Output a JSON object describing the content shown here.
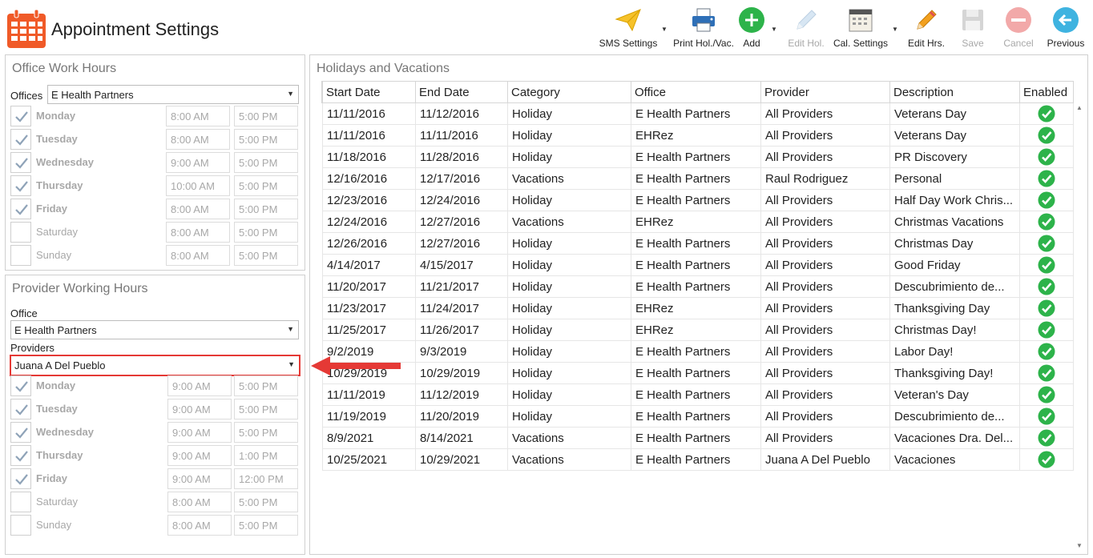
{
  "app": {
    "title": "Appointment Settings"
  },
  "toolbar": [
    {
      "id": "sms",
      "label": "SMS Settings",
      "icon": "paper-plane-icon",
      "enabled": true,
      "dropdown": true
    },
    {
      "id": "print",
      "label": "Print Hol./Vac.",
      "icon": "printer-icon",
      "enabled": true,
      "dropdown": false
    },
    {
      "id": "add",
      "label": "Add",
      "icon": "plus-circle-icon",
      "enabled": true,
      "dropdown": true
    },
    {
      "id": "edit_hol",
      "label": "Edit Hol.",
      "icon": "pencil-icon",
      "enabled": false,
      "dropdown": false
    },
    {
      "id": "cal",
      "label": "Cal. Settings",
      "icon": "calendar-icon",
      "enabled": true,
      "dropdown": true
    },
    {
      "id": "edit_hrs",
      "label": "Edit Hrs.",
      "icon": "pencil-icon",
      "enabled": true,
      "dropdown": false
    },
    {
      "id": "save",
      "label": "Save",
      "icon": "floppy-icon",
      "enabled": false,
      "dropdown": false
    },
    {
      "id": "cancel",
      "label": "Cancel",
      "icon": "cancel-circle-icon",
      "enabled": false,
      "dropdown": false
    },
    {
      "id": "previous",
      "label": "Previous",
      "icon": "arrow-left-circle-icon",
      "enabled": true,
      "dropdown": false
    }
  ],
  "office_hours": {
    "title": "Office Work Hours",
    "offices_label": "Offices",
    "office_value": "E Health Partners",
    "days": [
      {
        "day": "Monday",
        "checked": true,
        "start": "8:00 AM",
        "end": "5:00 PM"
      },
      {
        "day": "Tuesday",
        "checked": true,
        "start": "8:00 AM",
        "end": "5:00 PM"
      },
      {
        "day": "Wednesday",
        "checked": true,
        "start": "9:00 AM",
        "end": "5:00 PM"
      },
      {
        "day": "Thursday",
        "checked": true,
        "start": "10:00 AM",
        "end": "5:00 PM"
      },
      {
        "day": "Friday",
        "checked": true,
        "start": "8:00 AM",
        "end": "5:00 PM"
      },
      {
        "day": "Saturday",
        "checked": false,
        "start": "8:00 AM",
        "end": "5:00 PM"
      },
      {
        "day": "Sunday",
        "checked": false,
        "start": "8:00 AM",
        "end": "5:00 PM"
      }
    ]
  },
  "provider_hours": {
    "title": "Provider Working Hours",
    "office_label": "Office",
    "office_value": "E Health Partners",
    "providers_label": "Providers",
    "provider_value": "Juana A Del Pueblo",
    "days": [
      {
        "day": "Monday",
        "checked": true,
        "start": "9:00 AM",
        "end": "5:00 PM"
      },
      {
        "day": "Tuesday",
        "checked": true,
        "start": "9:00 AM",
        "end": "5:00 PM"
      },
      {
        "day": "Wednesday",
        "checked": true,
        "start": "9:00 AM",
        "end": "5:00 PM"
      },
      {
        "day": "Thursday",
        "checked": true,
        "start": "9:00 AM",
        "end": "1:00 PM"
      },
      {
        "day": "Friday",
        "checked": true,
        "start": "9:00 AM",
        "end": "12:00 PM"
      },
      {
        "day": "Saturday",
        "checked": false,
        "start": "8:00 AM",
        "end": "5:00 PM"
      },
      {
        "day": "Sunday",
        "checked": false,
        "start": "8:00 AM",
        "end": "5:00 PM"
      }
    ]
  },
  "holidays": {
    "title": "Holidays and Vacations",
    "columns": [
      "Start Date",
      "End Date",
      "Category",
      "Office",
      "Provider",
      "Description",
      "Enabled"
    ],
    "rows": [
      [
        "11/11/2016",
        "11/12/2016",
        "Holiday",
        "E Health Partners",
        "All Providers",
        "Veterans Day",
        true
      ],
      [
        "11/11/2016",
        "11/11/2016",
        "Holiday",
        "EHRez",
        "All Providers",
        "Veterans Day",
        true
      ],
      [
        "11/18/2016",
        "11/28/2016",
        "Holiday",
        "E Health Partners",
        "All Providers",
        "PR Discovery",
        true
      ],
      [
        "12/16/2016",
        "12/17/2016",
        "Vacations",
        "E Health Partners",
        "Raul Rodriguez",
        "Personal",
        true
      ],
      [
        "12/23/2016",
        "12/24/2016",
        "Holiday",
        "E Health Partners",
        "All Providers",
        "Half Day Work Chris...",
        true
      ],
      [
        "12/24/2016",
        "12/27/2016",
        "Vacations",
        "EHRez",
        "All Providers",
        "Christmas Vacations",
        true
      ],
      [
        "12/26/2016",
        "12/27/2016",
        "Holiday",
        "E Health Partners",
        "All Providers",
        "Christmas Day",
        true
      ],
      [
        "4/14/2017",
        "4/15/2017",
        "Holiday",
        "E Health Partners",
        "All Providers",
        "Good Friday",
        true
      ],
      [
        "11/20/2017",
        "11/21/2017",
        "Holiday",
        "E Health Partners",
        "All Providers",
        "Descubrimiento de...",
        true
      ],
      [
        "11/23/2017",
        "11/24/2017",
        "Holiday",
        "EHRez",
        "All Providers",
        "Thanksgiving Day",
        true
      ],
      [
        "11/25/2017",
        "11/26/2017",
        "Holiday",
        "EHRez",
        "All Providers",
        "Christmas Day!",
        true
      ],
      [
        "9/2/2019",
        "9/3/2019",
        "Holiday",
        "E Health Partners",
        "All Providers",
        "Labor Day!",
        true
      ],
      [
        "10/29/2019",
        "10/29/2019",
        "Holiday",
        "E Health Partners",
        "All Providers",
        "Thanksgiving Day!",
        true
      ],
      [
        "11/11/2019",
        "11/12/2019",
        "Holiday",
        "E Health Partners",
        "All Providers",
        "Veteran's Day",
        true
      ],
      [
        "11/19/2019",
        "11/20/2019",
        "Holiday",
        "E Health Partners",
        "All Providers",
        "Descubrimiento de...",
        true
      ],
      [
        "8/9/2021",
        "8/14/2021",
        "Vacations",
        "E Health Partners",
        "All Providers",
        "Vacaciones Dra. Del...",
        true
      ],
      [
        "10/25/2021",
        "10/29/2021",
        "Vacations",
        "E Health Partners",
        "Juana A Del Pueblo",
        "Vacaciones",
        true
      ]
    ]
  },
  "colors": {
    "accent_red": "#e53935",
    "enabled_green": "#2db34a",
    "app_icon_orange": "#f05a28"
  }
}
